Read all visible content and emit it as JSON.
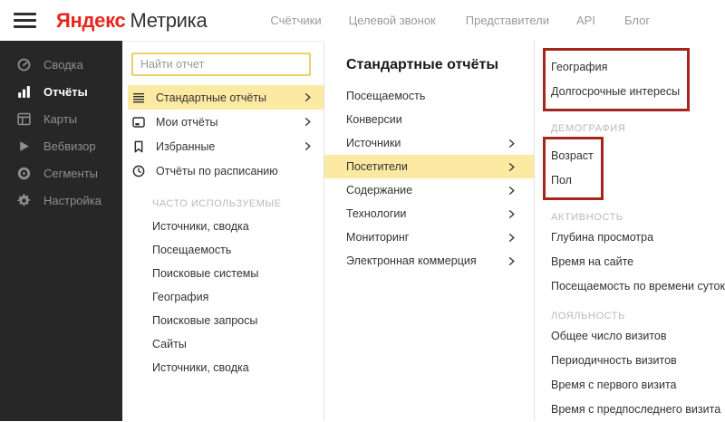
{
  "header": {
    "logo": {
      "brand": "Яндекс",
      "product": "Метрика"
    },
    "nav": [
      "Счётчики",
      "Целевой звонок",
      "Представители",
      "API",
      "Блог"
    ]
  },
  "sidebar": {
    "items": [
      {
        "label": "Сводка",
        "icon": "gauge-icon",
        "active": false
      },
      {
        "label": "Отчёты",
        "icon": "bar-chart-icon",
        "active": true
      },
      {
        "label": "Карты",
        "icon": "layout-icon",
        "active": false
      },
      {
        "label": "Вебвизор",
        "icon": "play-icon",
        "active": false
      },
      {
        "label": "Сегменты",
        "icon": "segments-icon",
        "active": false
      },
      {
        "label": "Настройка",
        "icon": "gear-icon",
        "active": false
      }
    ]
  },
  "report_menu": {
    "search_placeholder": "Найти отчет",
    "primary_items": [
      {
        "label": "Стандартные отчёты",
        "icon": "list-icon",
        "active": true,
        "has_submenu": true
      },
      {
        "label": "Мои отчёты",
        "icon": "window-icon",
        "active": false,
        "has_submenu": true
      },
      {
        "label": "Избранные",
        "icon": "bookmark-icon",
        "active": false,
        "has_submenu": true
      },
      {
        "label": "Отчёты по расписанию",
        "icon": "clock-icon",
        "active": false,
        "has_submenu": false
      }
    ],
    "frequent_section": {
      "title": "ЧАСТО ИСПОЛЬЗУЕМЫЕ",
      "items": [
        "Источники, сводка",
        "Посещаемость",
        "Поисковые системы",
        "География",
        "Поисковые запросы",
        "Сайты",
        "Источники, сводка"
      ]
    }
  },
  "standard_reports": {
    "title": "Стандартные отчёты",
    "items": [
      {
        "label": "Посещаемость",
        "has_submenu": false,
        "active": false
      },
      {
        "label": "Конверсии",
        "has_submenu": false,
        "active": false
      },
      {
        "label": "Источники",
        "has_submenu": true,
        "active": false
      },
      {
        "label": "Посетители",
        "has_submenu": true,
        "active": true
      },
      {
        "label": "Содержание",
        "has_submenu": true,
        "active": false
      },
      {
        "label": "Технологии",
        "has_submenu": true,
        "active": false
      },
      {
        "label": "Мониторинг",
        "has_submenu": true,
        "active": false
      },
      {
        "label": "Электронная коммерция",
        "has_submenu": true,
        "active": false
      }
    ]
  },
  "visitors_submenu": {
    "top_items": [
      "География",
      "Долгосрочные интересы"
    ],
    "sections": [
      {
        "title": "ДЕМОГРАФИЯ",
        "items": [
          "Возраст",
          "Пол"
        ],
        "highlighted": true
      },
      {
        "title": "АКТИВНОСТЬ",
        "items": [
          "Глубина просмотра",
          "Время на сайте",
          "Посещаемость по времени суток"
        ],
        "highlighted": false
      },
      {
        "title": "ЛОЯЛЬНОСТЬ",
        "items": [
          "Общее число визитов",
          "Периодичность визитов",
          "Время с первого визита",
          "Время с предпоследнего визита"
        ],
        "highlighted": false
      }
    ]
  },
  "colors": {
    "brand_red": "#e8261c",
    "highlight_yellow": "#fce9a2",
    "annotation_red": "#a5261e",
    "sidebar_bg": "#272727",
    "search_border_yellow": "#ecd06e"
  }
}
